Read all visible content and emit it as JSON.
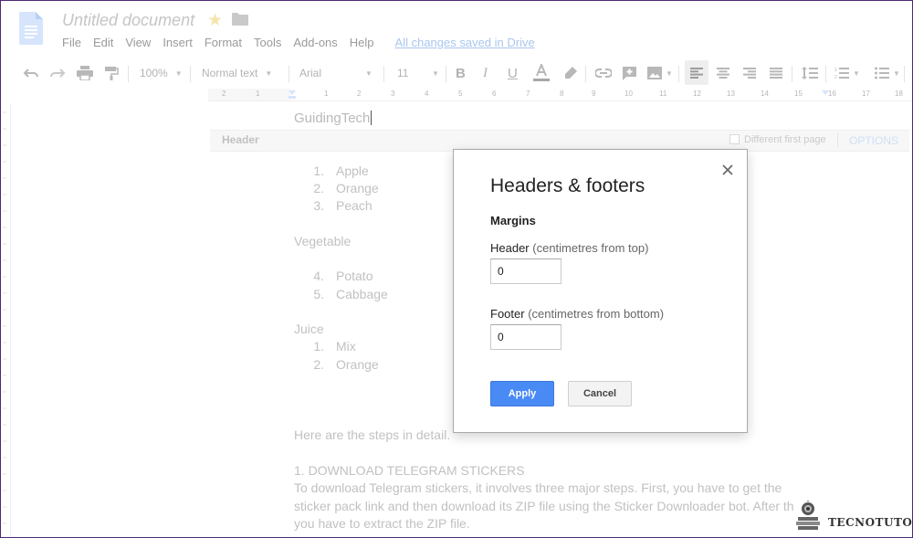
{
  "app": {
    "doc_title": "Untitled document",
    "menu": [
      "File",
      "Edit",
      "View",
      "Insert",
      "Format",
      "Tools",
      "Add-ons",
      "Help"
    ],
    "save_status": "All changes saved in Drive"
  },
  "toolbar": {
    "zoom": "100%",
    "style": "Normal text",
    "font": "Arial",
    "font_size": "11"
  },
  "ruler": {
    "numbers": [
      "2",
      "1",
      "1",
      "2",
      "3",
      "4",
      "5",
      "6",
      "7",
      "8",
      "9",
      "10",
      "11",
      "12",
      "13",
      "14",
      "15",
      "16",
      "17",
      "18"
    ]
  },
  "document": {
    "header_text": "GuidingTech",
    "header_bar": {
      "label": "Header",
      "different_first_page": "Different first page",
      "options": "OPTIONS"
    },
    "list1": [
      {
        "num": "1.",
        "text": "Apple"
      },
      {
        "num": "2.",
        "text": "Orange"
      },
      {
        "num": "3.",
        "text": "Peach"
      }
    ],
    "heading_vegetable": "Vegetable",
    "list2": [
      {
        "num": "4.",
        "text": "Potato"
      },
      {
        "num": "5.",
        "text": "Cabbage"
      }
    ],
    "heading_juice": "Juice",
    "list3": [
      {
        "num": "1.",
        "text": "Mix"
      },
      {
        "num": "2.",
        "text": "Orange"
      }
    ],
    "steps_intro": "Here are the steps in detail.",
    "step1_title": "1. DOWNLOAD TELEGRAM STICKERS",
    "para_lines": [
      "To download Telegram stickers, it involves three major steps. First, you have to get the",
      "sticker pack link and then download its ZIP file using the Sticker Downloader bot. After th",
      "you have to extract the ZIP file."
    ]
  },
  "dialog": {
    "title": "Headers & footers",
    "section": "Margins",
    "header_label": "Header",
    "header_hint": "(centimetres from top)",
    "header_value": "0",
    "footer_label": "Footer",
    "footer_hint": "(centimetres from bottom)",
    "footer_value": "0",
    "apply": "Apply",
    "cancel": "Cancel"
  },
  "watermark": {
    "text": "TECNOTUTO"
  },
  "colors": {
    "accent_blue": "#4a8af4",
    "doc_icon_blue": "#4285f4",
    "star": "#f6e4ad"
  }
}
